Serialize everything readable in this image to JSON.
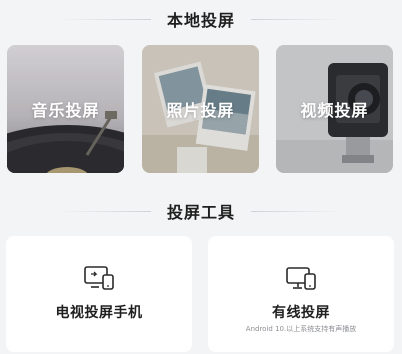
{
  "local_section": {
    "title": "本地投屏",
    "cards": [
      {
        "label": "音乐投屏"
      },
      {
        "label": "照片投屏"
      },
      {
        "label": "视频投屏"
      }
    ]
  },
  "tools_section": {
    "title": "投屏工具",
    "tools": [
      {
        "label": "电视投屏手机",
        "icon": "tv-phone-icon"
      },
      {
        "label": "有线投屏",
        "subtitle": "Android 10.以上系统支持有声播放",
        "icon": "monitor-phone-icon"
      }
    ]
  },
  "colors": {
    "background": "#f3f4f6",
    "card": "#ffffff",
    "text": "#1f1f1f",
    "subtext": "#8d8f94"
  }
}
